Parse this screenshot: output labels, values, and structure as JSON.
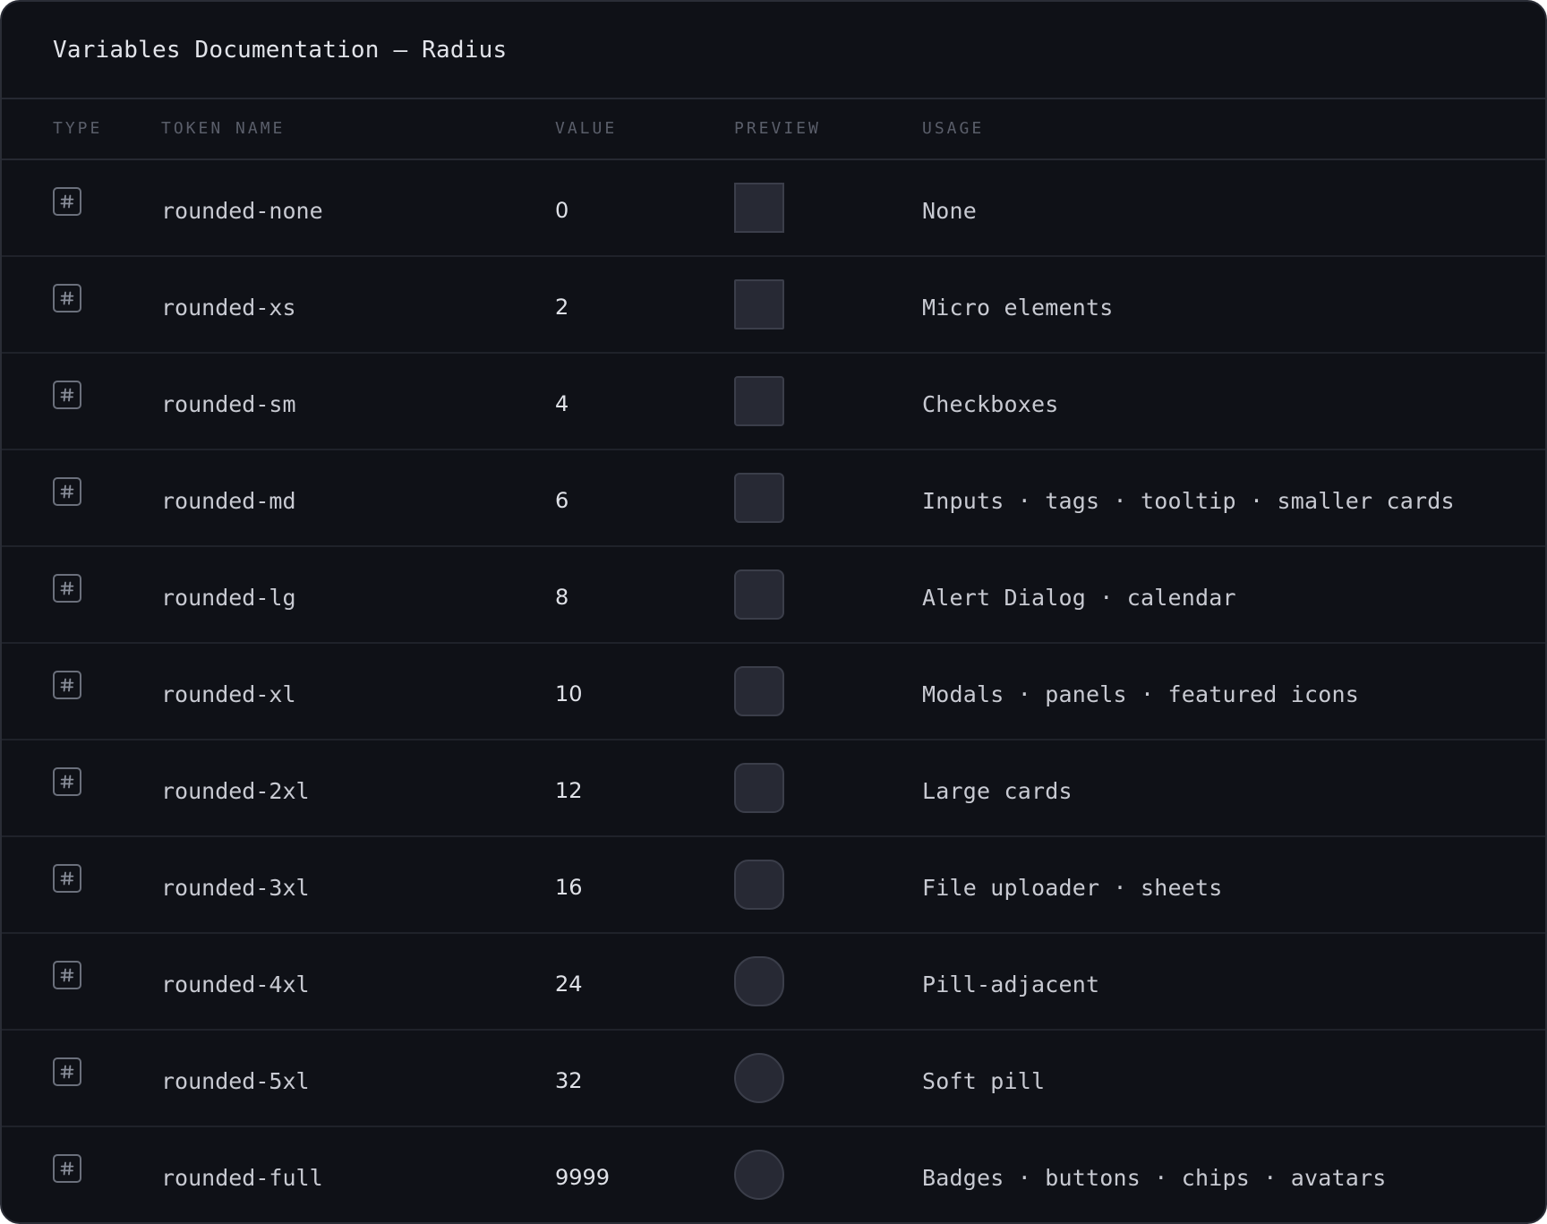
{
  "title": "Variables Documentation — Radius",
  "columns": {
    "type": "TYPE",
    "token_name": "TOKEN NAME",
    "value": "VALUE",
    "preview": "PREVIEW",
    "usage": "USAGE"
  },
  "type_icon": "hash-icon",
  "colors": {
    "background": "#0f1117",
    "swatch_fill": "#272934",
    "swatch_border": "#3b3e4a",
    "divider": "#262932"
  },
  "rows": [
    {
      "name": "rounded-none",
      "value": "0",
      "usage": "None"
    },
    {
      "name": "rounded-xs",
      "value": "2",
      "usage": "Micro elements"
    },
    {
      "name": "rounded-sm",
      "value": "4",
      "usage": "Checkboxes"
    },
    {
      "name": "rounded-md",
      "value": "6",
      "usage": "Inputs · tags · tooltip · smaller cards"
    },
    {
      "name": "rounded-lg",
      "value": "8",
      "usage": "Alert Dialog · calendar"
    },
    {
      "name": "rounded-xl",
      "value": "10",
      "usage": "Modals · panels · featured icons"
    },
    {
      "name": "rounded-2xl",
      "value": "12",
      "usage": "Large cards"
    },
    {
      "name": "rounded-3xl",
      "value": "16",
      "usage": "File uploader · sheets"
    },
    {
      "name": "rounded-4xl",
      "value": "24",
      "usage": "Pill-adjacent"
    },
    {
      "name": "rounded-5xl",
      "value": "32",
      "usage": "Soft pill"
    },
    {
      "name": "rounded-full",
      "value": "9999",
      "usage": "Badges · buttons · chips · avatars"
    }
  ]
}
